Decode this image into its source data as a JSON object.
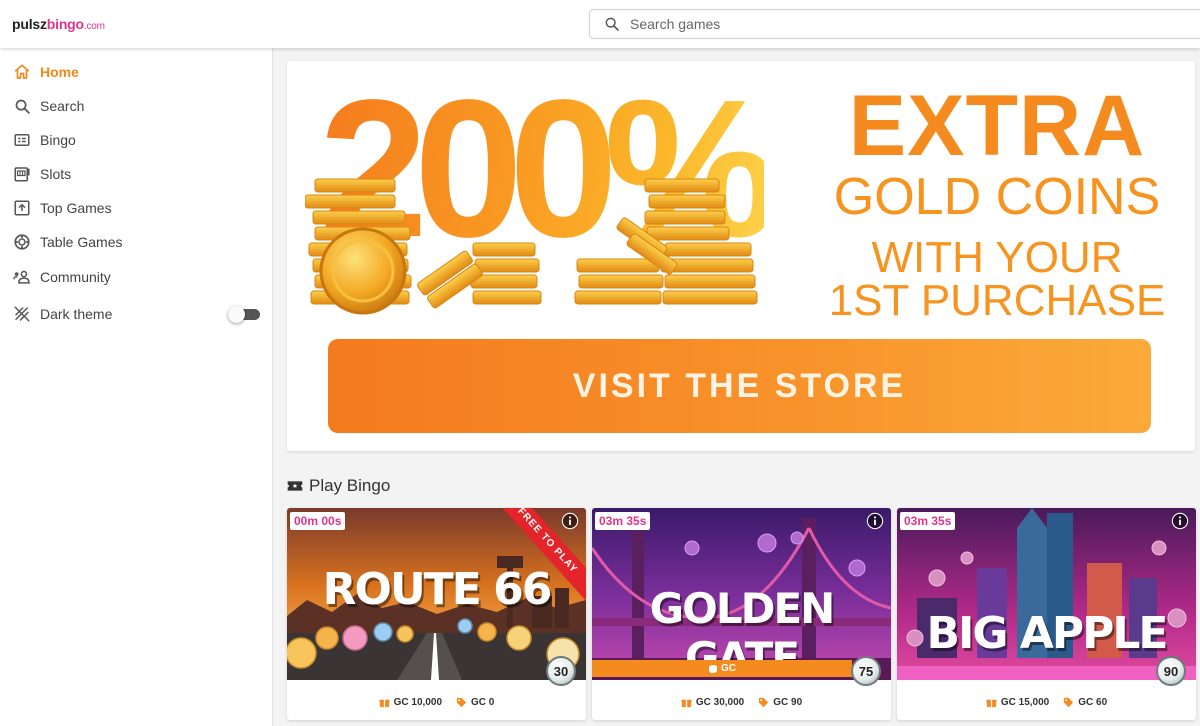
{
  "brand": {
    "name_a": "pulsz",
    "name_b": "bingo",
    "name_c": ".com"
  },
  "search": {
    "placeholder": "Search games"
  },
  "sidebar": {
    "items": [
      {
        "label": "Home",
        "icon": "home-icon",
        "active": true
      },
      {
        "label": "Search",
        "icon": "search-icon"
      },
      {
        "label": "Bingo",
        "icon": "bingo-card-icon"
      },
      {
        "label": "Slots",
        "icon": "slot-machine-icon"
      },
      {
        "label": "Top Games",
        "icon": "top-games-icon"
      },
      {
        "label": "Table Games",
        "icon": "poker-chip-icon"
      },
      {
        "label": "Community",
        "icon": "community-icon"
      },
      {
        "label": "Dark theme",
        "icon": "dark-theme-icon"
      }
    ],
    "dark_theme_enabled": false
  },
  "banner": {
    "percent": "200%",
    "line1": "EXTRA",
    "line2": "GOLD COINS",
    "line3": "WITH YOUR",
    "line4": "1ST PURCHASE",
    "cta": "VISIT THE STORE"
  },
  "section": {
    "title": "Play Bingo",
    "icon": "ticket-icon"
  },
  "games": [
    {
      "title": "ROUTE 66",
      "timer": "00m 00s",
      "ribbon": "FREE TO PLAY",
      "count": "30",
      "gc_price": "GC 10,000",
      "gc_prize": "GC 0",
      "accent": "#e3242b"
    },
    {
      "title": "GOLDEN GATE",
      "timer": "03m 35s",
      "gc_bar": "GC",
      "count": "75",
      "gc_price": "GC 30,000",
      "gc_prize": "GC 90",
      "accent": "#f58a1f"
    },
    {
      "title": "BIG APPLE",
      "timer": "03m 35s",
      "count": "90",
      "gc_price": "GC 15,000",
      "gc_prize": "GC 60",
      "accent": "#e0338c"
    }
  ],
  "colors": {
    "accent": "#f0881c",
    "brand_pink": "#e0338c"
  }
}
